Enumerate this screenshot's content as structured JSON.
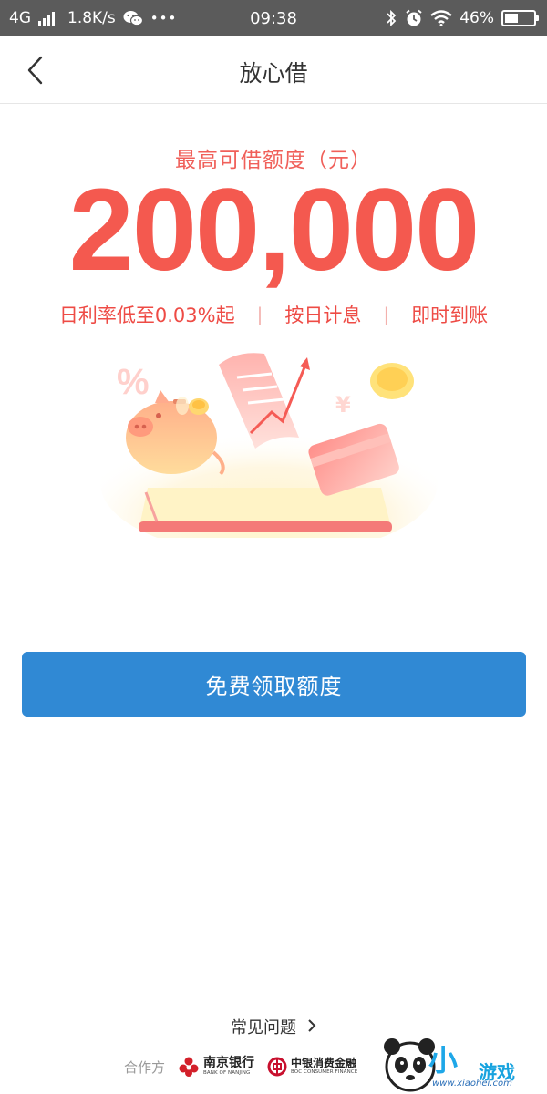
{
  "status_bar": {
    "network": "4G",
    "speed": "1.8K/s",
    "time": "09:38",
    "battery_percent_text": "46%",
    "battery_level": 0.46,
    "icons": [
      "signal-icon",
      "wechat-icon",
      "more-icon",
      "bluetooth-icon",
      "alarm-icon",
      "wifi-icon",
      "battery-icon"
    ],
    "more": "•••"
  },
  "nav": {
    "title": "放心借",
    "back_icon": "chevron-left-icon"
  },
  "hero": {
    "quota_label": "最高可借额度（元）",
    "quota_amount": "200,000",
    "features": [
      "日利率低至0.03%起",
      "按日计息",
      "即时到账"
    ],
    "separator": "|",
    "illustration": "piggy-bank-coins-illustration"
  },
  "cta": {
    "label": "免费领取额度"
  },
  "footer": {
    "faq_label": "常见问题",
    "faq_icon": "chevron-right-icon",
    "partners_label": "合作方",
    "partners": [
      {
        "name": "南京银行",
        "subtitle": "BANK OF NANJING",
        "logo": "bank-of-nanjing-logo"
      },
      {
        "name": "中银消费金融",
        "subtitle": "BOC CONSUMER FINANCE",
        "logo": "boc-logo"
      }
    ]
  },
  "watermark": {
    "name": "小黑游戏",
    "mark": "小",
    "game": "游戏",
    "url": "www.xiaohei.com"
  },
  "colors": {
    "status_bar_bg": "#5b5b5b",
    "accent_red": "#f4594f",
    "feature_red": "#ee4b45",
    "button_blue": "#3089d4",
    "watermark_blue": "#1ea7e8"
  }
}
